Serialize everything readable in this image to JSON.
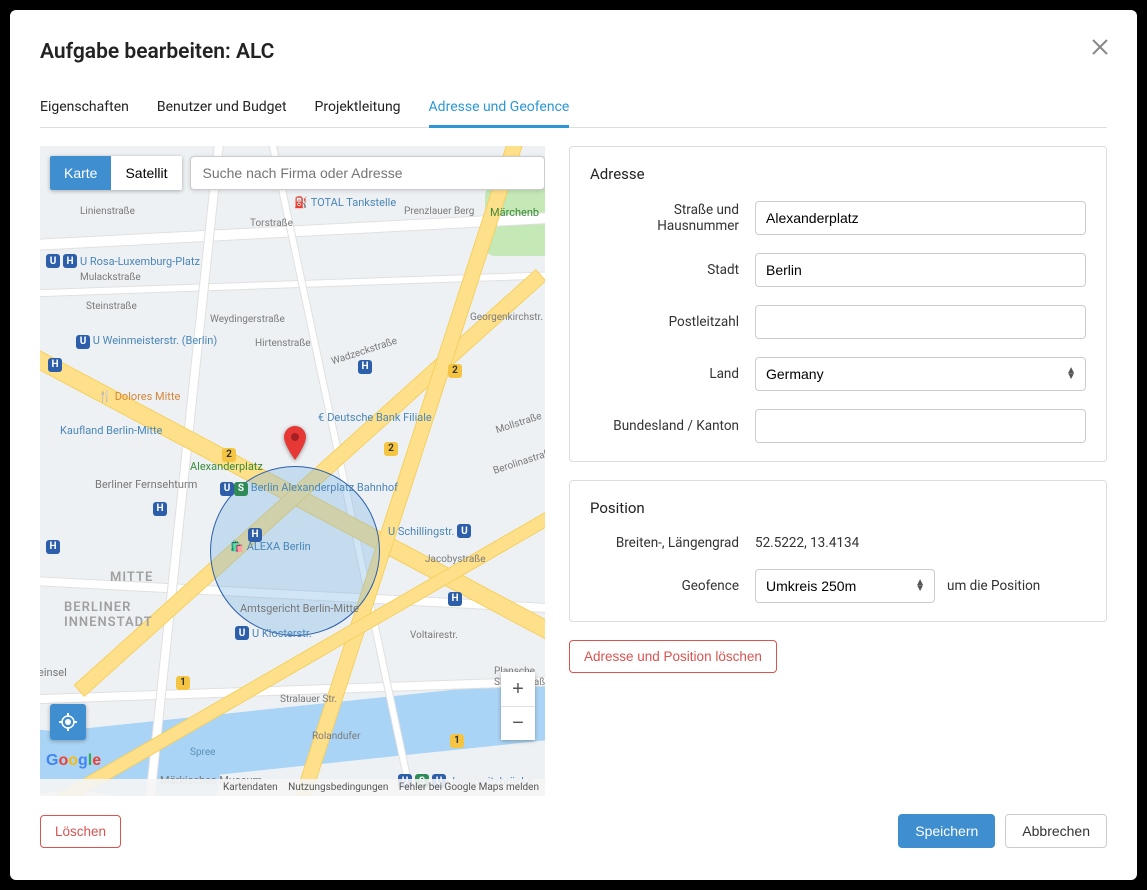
{
  "modal": {
    "title": "Aufgabe bearbeiten: ALC"
  },
  "tabs": [
    {
      "label": "Eigenschaften",
      "active": false
    },
    {
      "label": "Benutzer und Budget",
      "active": false
    },
    {
      "label": "Projektleitung",
      "active": false
    },
    {
      "label": "Adresse und Geofence",
      "active": true
    }
  ],
  "map": {
    "type_karte": "Karte",
    "type_satellit": "Satellit",
    "search_placeholder": "Suche nach Firma oder Adresse",
    "footer_kartendaten": "Kartendaten",
    "footer_terms": "Nutzungsbedingungen",
    "footer_report": "Fehler bei Google Maps melden",
    "districts": {
      "mitte": "MITTE",
      "berliner_innenstadt": "BERLINER\nINNENSTADT"
    },
    "roads": {
      "torstrasse": "Torstraße",
      "linienstrasse": "Linienstraße",
      "mulackstrasse": "Mulackstraße",
      "steinstrasse": "Steinstraße",
      "weydingerstrasse": "Weydingerstraße",
      "hirtenstrasse": "Hirtenstraße",
      "wadzeckstrasse": "Wadzeckstraße",
      "jacobystrasse": "Jacobystraße",
      "stralauer": "Stralauer Str.",
      "rolandufer": "Rolandufer",
      "spree": "Spree",
      "voltairestr": "Voltairestr.",
      "mollstrasse": "Mollstraße",
      "berolinastrasse": "Berolinastraße",
      "georgenkirchstr": "Georgenkirchstr.",
      "prenzlauer": "Prenzlauer Berg",
      "plansche": "Plansche Singerstraße"
    },
    "pois": {
      "total": "TOTAL Tankstelle",
      "marchenb": "Märchenb",
      "rosa_luxemburg": "U Rosa-Luxemburg-Platz",
      "weinmeister": "U Weinmeisterstr. (Berlin)",
      "dolores": "Dolores Mitte",
      "deutsche_bank": "Deutsche Bank Filiale",
      "kaufland": "Kaufland Berlin-Mitte",
      "alexanderplatz": "Alexanderplatz",
      "fernsehturm": "Berliner Fernsehturm",
      "alex_bahnhof": "Berlin Alexanderplatz Bahnhof",
      "alexa": "ALEXA Berlin",
      "schillingstr": "U Schillingstr.",
      "amtsgericht": "Amtsgericht Berlin-Mitte",
      "klosterstr": "U Klosterstr.",
      "markisches": "Märkisches Museum",
      "jannowitz": "Jannowitzbrücke",
      "einsel": "einsel"
    }
  },
  "address_panel": {
    "title": "Adresse",
    "street_label": "Straße und Hausnummer",
    "street_value": "Alexanderplatz",
    "city_label": "Stadt",
    "city_value": "Berlin",
    "zip_label": "Postleitzahl",
    "zip_value": "",
    "country_label": "Land",
    "country_value": "Germany",
    "state_label": "Bundesland / Kanton",
    "state_value": ""
  },
  "position_panel": {
    "title": "Position",
    "latlng_label": "Breiten-, Längengrad",
    "latlng_value": "52.5222, 13.4134",
    "geofence_label": "Geofence",
    "geofence_value": "Umkreis 250m",
    "geofence_suffix": "um die Position"
  },
  "actions": {
    "clear_address": "Adresse und Position löschen",
    "delete": "Löschen",
    "save": "Speichern",
    "cancel": "Abbrechen"
  }
}
